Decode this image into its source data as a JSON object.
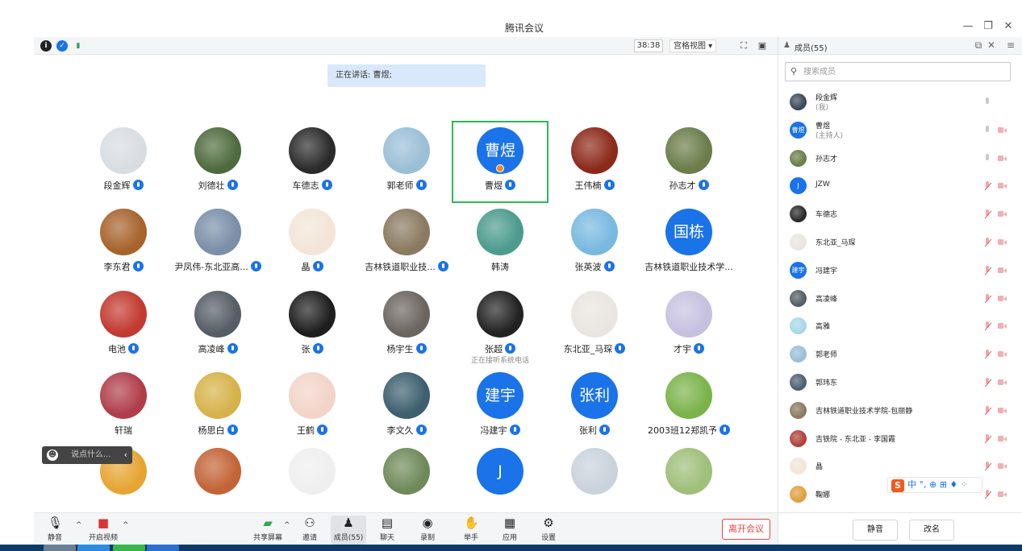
{
  "window": {
    "title": "腾讯会议",
    "controls": [
      "—",
      "❐",
      "✕"
    ]
  },
  "topbar": {
    "timer": "38:38",
    "view_mode": "宫格视图 ▾"
  },
  "speaking": "正在讲话: 曹煜;",
  "participants": [
    {
      "name": "段金辉",
      "avatar": "img",
      "color": "#d8dde2",
      "mic": true
    },
    {
      "name": "刘德壮",
      "avatar": "img",
      "color": "#4f6b3e",
      "mic": true
    },
    {
      "name": "车德志",
      "avatar": "img",
      "color": "#2b2b2b",
      "mic": true
    },
    {
      "name": "郭老师",
      "avatar": "img",
      "color": "#9bbfd6",
      "mic": true
    },
    {
      "name": "曹煜",
      "avatar": "text",
      "text": "曹煜",
      "mic": true,
      "active": true,
      "host": true
    },
    {
      "name": "王伟楠",
      "avatar": "img",
      "color": "#8c2a1a",
      "mic": true
    },
    {
      "name": "孙志才",
      "avatar": "img",
      "color": "#6a7d4a",
      "mic": true
    },
    {
      "name": "李东君",
      "avatar": "img",
      "color": "#a6632c",
      "mic": true
    },
    {
      "name": "尹凤伟-东北亚高...",
      "avatar": "img",
      "color": "#7a8fa8",
      "mic": true
    },
    {
      "name": "晶",
      "avatar": "img",
      "color": "#f3e5d8",
      "mic": true
    },
    {
      "name": "吉林铁道职业技...",
      "avatar": "img",
      "color": "#8a7a60",
      "mic": true
    },
    {
      "name": "韩涛",
      "avatar": "img",
      "color": "#4c9b8e",
      "mic": false
    },
    {
      "name": "张英波",
      "avatar": "img",
      "color": "#79b9e0",
      "mic": true
    },
    {
      "name": "吉林铁道职业技术学...",
      "avatar": "text",
      "text": "国栋",
      "mic": false
    },
    {
      "name": "电池",
      "avatar": "img",
      "color": "#c23a30",
      "mic": true
    },
    {
      "name": "高凌峰",
      "avatar": "img",
      "color": "#555d66",
      "mic": true
    },
    {
      "name": "张",
      "avatar": "img",
      "color": "#1e1e1e",
      "mic": true
    },
    {
      "name": "杨宇生",
      "avatar": "img",
      "color": "#6b6560",
      "mic": true
    },
    {
      "name": "张超",
      "avatar": "img",
      "color": "#222222",
      "mic": true,
      "sub": "正在接听系统电话"
    },
    {
      "name": "东北亚_马琛",
      "avatar": "img",
      "color": "#e9e5e0",
      "mic": true
    },
    {
      "name": "才宇",
      "avatar": "img",
      "color": "#c7c1e0",
      "mic": true
    },
    {
      "name": "轩瑞",
      "avatar": "img",
      "color": "#b03e4a",
      "mic": false
    },
    {
      "name": "杨思白",
      "avatar": "img",
      "color": "#d7b24a",
      "mic": true
    },
    {
      "name": "王鹤",
      "avatar": "img",
      "color": "#f2d4c8",
      "mic": true
    },
    {
      "name": "李文久",
      "avatar": "img",
      "color": "#3d5f6e",
      "mic": true
    },
    {
      "name": "冯建宇",
      "avatar": "text",
      "text": "建宇",
      "mic": true
    },
    {
      "name": "张利",
      "avatar": "text",
      "text": "张利",
      "mic": true
    },
    {
      "name": "2003班12郑凯予",
      "avatar": "img",
      "color": "#7ab34a",
      "mic": true
    },
    {
      "name": "",
      "avatar": "img",
      "color": "#e6a532",
      "mic": false
    },
    {
      "name": "",
      "avatar": "img",
      "color": "#c26436",
      "mic": false
    },
    {
      "name": "",
      "avatar": "img",
      "color": "#efefef",
      "mic": false
    },
    {
      "name": "",
      "avatar": "img",
      "color": "#6f8a5a",
      "mic": false
    },
    {
      "name": "",
      "avatar": "text",
      "text": "J",
      "mic": false
    },
    {
      "name": "",
      "avatar": "img",
      "color": "#c9d3dc",
      "mic": false
    },
    {
      "name": "",
      "avatar": "img",
      "color": "#9fbf7a",
      "mic": false
    }
  ],
  "chat_input": {
    "placeholder": "说点什么..."
  },
  "toolbar": {
    "mute": "静音",
    "video": "开启视频",
    "share": "共享屏幕",
    "invite": "邀请",
    "members": "成员(55)",
    "chat": "聊天",
    "record": "录制",
    "raise_hand": "举手",
    "apps": "应用",
    "settings": "设置",
    "leave": "离开会议"
  },
  "panel": {
    "title": "成员(55)",
    "search_placeholder": "搜索成员",
    "members": [
      {
        "name": "段金辉",
        "role": "(我)",
        "avatar": "img",
        "color": "#3b4a5a",
        "mic": "on",
        "cam": false
      },
      {
        "name": "曹煜",
        "role": "(主持人)",
        "avatar": "text",
        "text": "曹煜",
        "mic": "on",
        "cam": true
      },
      {
        "name": "孙志才",
        "avatar": "img",
        "color": "#6a7d4a",
        "mic": "on",
        "cam": true
      },
      {
        "name": "JZW",
        "avatar": "text",
        "text": "J",
        "mic": "off",
        "cam": true
      },
      {
        "name": "车德志",
        "avatar": "img",
        "color": "#2b2b2b",
        "mic": "off",
        "cam": true
      },
      {
        "name": "东北亚_马琛",
        "avatar": "img",
        "color": "#e9e5e0",
        "mic": "off",
        "cam": true
      },
      {
        "name": "冯建宇",
        "avatar": "text",
        "text": "建宇",
        "mic": "off",
        "cam": true
      },
      {
        "name": "高凌峰",
        "avatar": "img",
        "color": "#555d66",
        "mic": "off",
        "cam": true
      },
      {
        "name": "高雅",
        "avatar": "img",
        "color": "#a8d8e8",
        "mic": "off",
        "cam": true
      },
      {
        "name": "郭老师",
        "avatar": "img",
        "color": "#9bbfd6",
        "mic": "off",
        "cam": true
      },
      {
        "name": "郭玮东",
        "avatar": "img",
        "color": "#4d6070",
        "mic": "off",
        "cam": true
      },
      {
        "name": "吉林铁道职业技术学院-包丽静",
        "avatar": "img",
        "color": "#8a7a60",
        "mic": "off",
        "cam": true
      },
      {
        "name": "吉铁院 - 东北亚 - 李国霞",
        "avatar": "img",
        "color": "#b0413a",
        "mic": "off",
        "cam": true
      },
      {
        "name": "晶",
        "avatar": "img",
        "color": "#f3e5d8",
        "mic": "off",
        "cam": true
      },
      {
        "name": "鞠娜",
        "avatar": "img",
        "color": "#e0a040",
        "mic": "off",
        "cam": true
      }
    ],
    "mute_all": "静音",
    "rename": "改名"
  },
  "ime": {
    "label": "中 °, ⊕ ⊞ ♦ ⁘"
  }
}
